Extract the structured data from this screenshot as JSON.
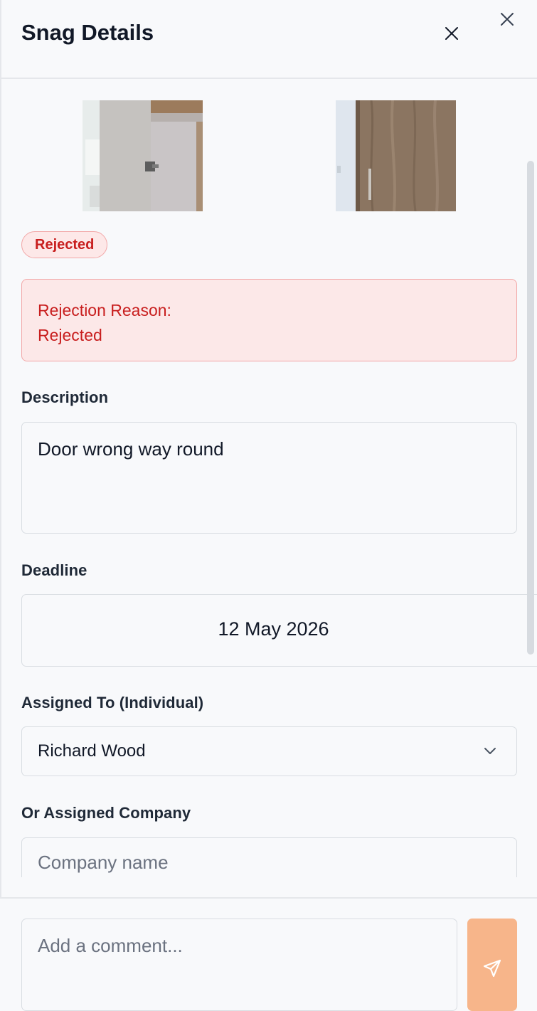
{
  "header": {
    "title": "Snag Details"
  },
  "icons": {
    "close_outer": "close-icon",
    "close_inner": "close-icon",
    "dropdown": "chevron-down-icon",
    "send": "send-icon"
  },
  "photos": [
    {
      "alt": ""
    },
    {
      "alt": ""
    }
  ],
  "status": {
    "label": "Rejected",
    "bg_color": "#fde8e8",
    "text_color": "#c81e1e"
  },
  "rejection": {
    "label": "Rejection Reason:",
    "reason": "Rejected"
  },
  "description": {
    "label": "Description",
    "value": "Door wrong way round"
  },
  "deadline": {
    "label": "Deadline",
    "value": "12 May 2026"
  },
  "assigned_individual": {
    "label": "Assigned To (Individual)",
    "value": "Richard Wood"
  },
  "assigned_company": {
    "label": "Or Assigned Company",
    "placeholder": "Company name"
  },
  "comment": {
    "placeholder": "Add a comment..."
  },
  "colors": {
    "accent_send": "#f7b58a",
    "danger": "#c81e1e"
  }
}
